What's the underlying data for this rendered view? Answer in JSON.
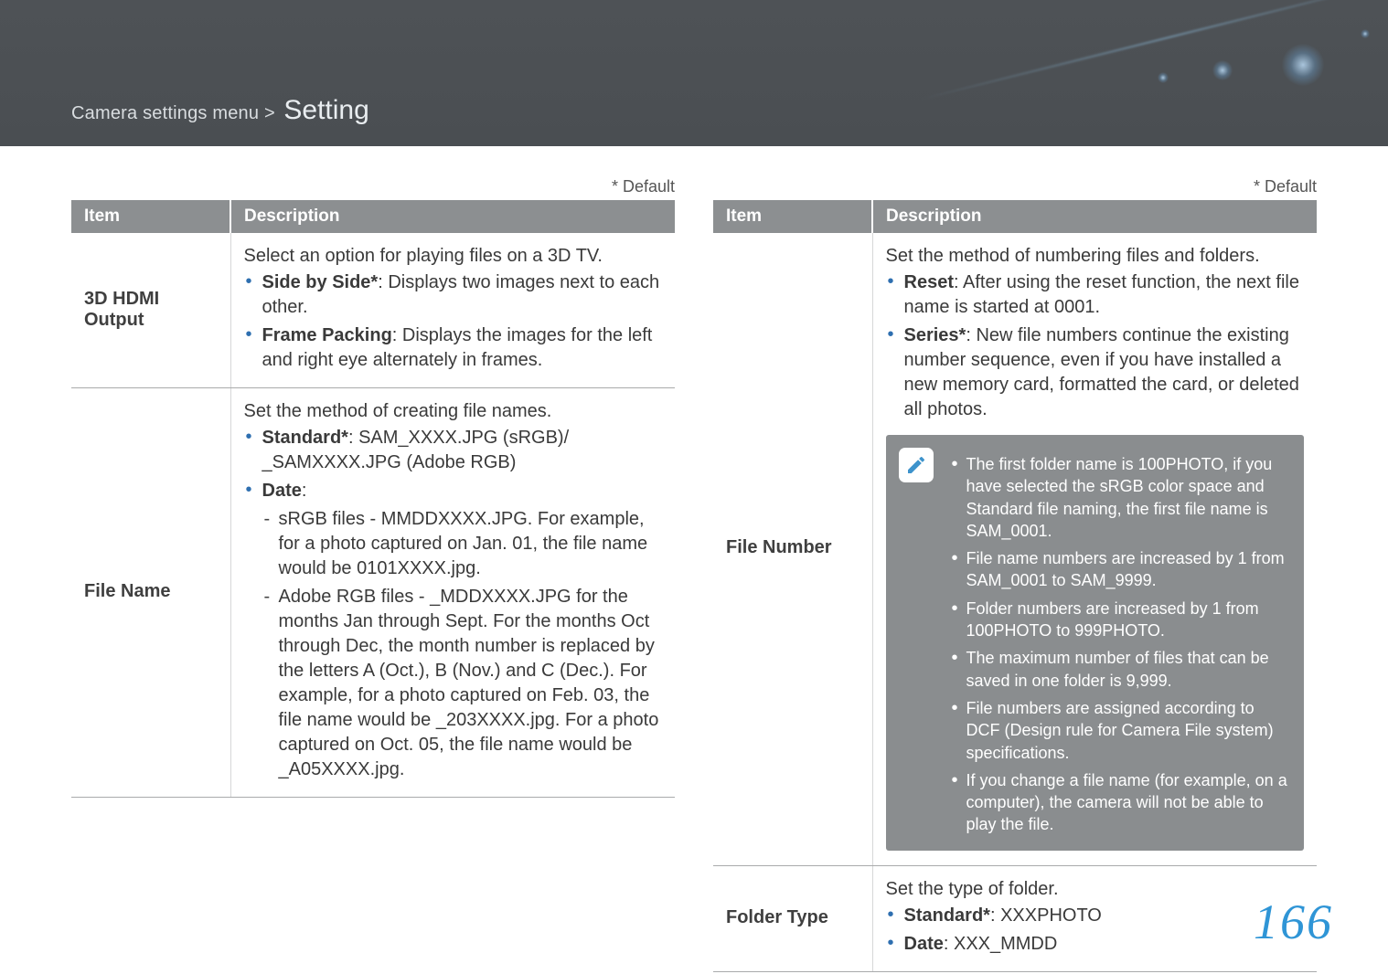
{
  "header": {
    "breadcrumb_prefix": "Camera settings menu >",
    "breadcrumb_main": "Setting"
  },
  "default_note": "* Default",
  "table_headers": {
    "item": "Item",
    "description": "Description"
  },
  "left_table": [
    {
      "item": "3D HDMI Output",
      "intro": "Select an option for playing files on a 3D TV.",
      "bullets": [
        {
          "title": "Side by Side*",
          "text": ": Displays two images next to each other."
        },
        {
          "title": "Frame Packing",
          "text": ": Displays the images for the left and right eye alternately in frames."
        }
      ]
    },
    {
      "item": "File Name",
      "intro": "Set the method of creating file names.",
      "bullets": [
        {
          "title": "Standard*",
          "text": ": SAM_XXXX.JPG (sRGB)/ _SAMXXXX.JPG (Adobe RGB)"
        },
        {
          "title": "Date",
          "text": ":",
          "sub": [
            "sRGB files - MMDDXXXX.JPG. For example, for a photo captured on Jan. 01, the file name would be 0101XXXX.jpg.",
            "Adobe RGB files - _MDDXXXX.JPG for the months Jan through Sept. For the months Oct through Dec, the month number is replaced by the letters A (Oct.), B (Nov.) and C (Dec.). For example, for a photo captured on Feb. 03, the file name would be _203XXXX.jpg. For a photo captured on Oct. 05, the file name would be _A05XXXX.jpg."
          ]
        }
      ]
    }
  ],
  "right_table": [
    {
      "item": "File Number",
      "intro": "Set the method of numbering files and folders.",
      "bullets": [
        {
          "title": "Reset",
          "text": ": After using the reset function, the next file name is started at 0001."
        },
        {
          "title": "Series*",
          "text": ": New file numbers continue the existing number sequence, even if you have installed a new memory card, formatted the card, or deleted all photos."
        }
      ],
      "note": [
        "The first folder name is 100PHOTO, if you have selected the sRGB color space and Standard file naming, the first file name is SAM_0001.",
        "File name numbers are increased by 1 from SAM_0001 to SAM_9999.",
        "Folder numbers are increased by 1 from 100PHOTO to 999PHOTO.",
        "The maximum number of files that can be saved in one folder is 9,999.",
        "File numbers are assigned according to DCF (Design rule for Camera File system) specifications.",
        "If you change a file name (for example, on a computer), the camera will not be able to play the file."
      ]
    },
    {
      "item": "Folder Type",
      "intro": "Set the type of folder.",
      "bullets": [
        {
          "title": "Standard*",
          "text": ": XXXPHOTO"
        },
        {
          "title": "Date",
          "text": ": XXX_MMDD"
        }
      ]
    }
  ],
  "page_number": "166"
}
